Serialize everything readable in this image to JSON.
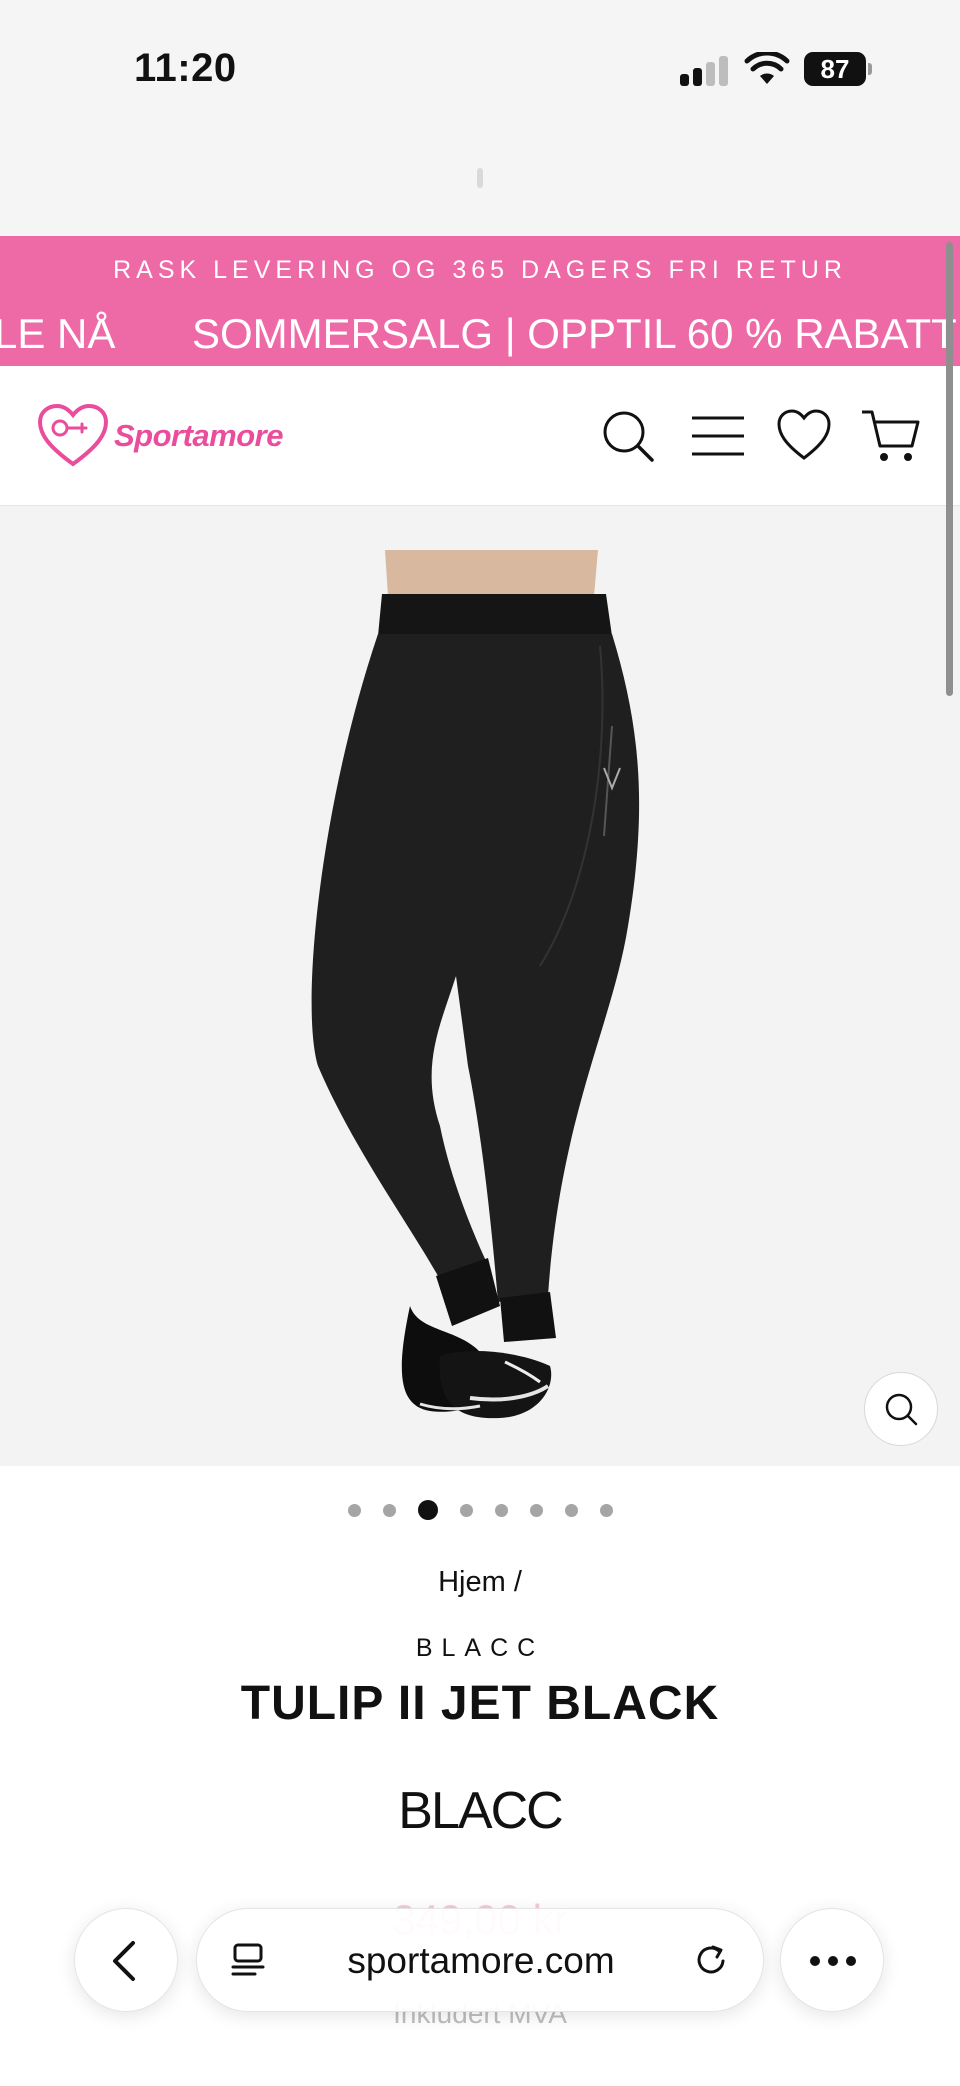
{
  "status_bar": {
    "time": "11:20",
    "battery": "87"
  },
  "promo": {
    "top_line": "RASK LEVERING OG 365 DAGERS FRI RETUR",
    "ticker_left": "LE NÅ",
    "ticker_right": "SOMMERSALG | OPPTIL 60 % RABATT",
    "background_color": "#ee6aa7"
  },
  "header": {
    "logo_text": "Sportamore",
    "icons": [
      "search-icon",
      "menu-icon",
      "heart-icon",
      "cart-icon"
    ],
    "brand_color": "#e94d9b"
  },
  "gallery": {
    "image_count": 8,
    "active_index": 3
  },
  "product": {
    "breadcrumb": "Hjem /",
    "brand": "BLACC",
    "title": "TULIP II JET BLACK",
    "brand_logo_text": "BLACC",
    "price": "349,00 kr",
    "vat_note": "Inkludert MVA"
  },
  "browser": {
    "url": "sportamore.com"
  }
}
